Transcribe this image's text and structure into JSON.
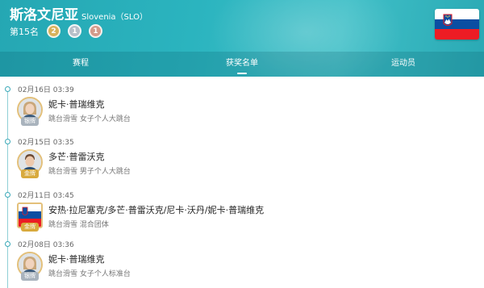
{
  "header": {
    "country_cn": "斯洛文尼亚",
    "country_en": "Slovenia（SLO）",
    "rank": "第15名",
    "medals": [
      {
        "type": "gold",
        "count": "2"
      },
      {
        "type": "silver",
        "count": "1"
      },
      {
        "type": "bronze",
        "count": "1"
      }
    ],
    "flag_colors": {
      "top": "#ffffff",
      "middle": "#0b4ea2",
      "bottom": "#ed1c24"
    }
  },
  "tabs": [
    {
      "label": "赛程",
      "active": false
    },
    {
      "label": "获奖名单",
      "active": true
    },
    {
      "label": "运动员",
      "active": false
    }
  ],
  "entries": [
    {
      "time": "02月16日 03:39",
      "name": "妮卡·普瑞维克",
      "event": "跳台滑雪 女子个人大跳台",
      "medal": "银牌",
      "avatar": "female-athlete"
    },
    {
      "time": "02月15日 03:35",
      "name": "多芒·普雷沃克",
      "event": "跳台滑雪 男子个人大跳台",
      "medal": "金牌",
      "avatar": "male-athlete"
    },
    {
      "time": "02月11日 03:45",
      "name": "安热·拉尼塞克/多芒·普雷沃克/尼卡·沃丹/妮卡·普瑞维克",
      "event": "跳台滑雪 混合团体",
      "medal": "金牌",
      "avatar": "team-flag"
    },
    {
      "time": "02月08日 03:36",
      "name": "妮卡·普瑞维克",
      "event": "跳台滑雪 女子个人标准台",
      "medal": "银牌",
      "avatar": "female-athlete"
    }
  ]
}
